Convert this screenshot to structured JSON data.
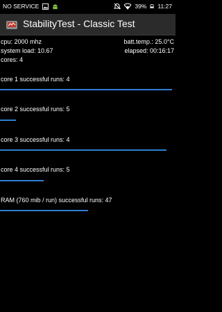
{
  "status_bar": {
    "carrier": "NO SERVICE",
    "battery": "39%",
    "time": "11:27"
  },
  "header": {
    "title": "StabilityTest - Classic Test"
  },
  "stats": {
    "cpu": "cpu: 2000 mhz",
    "batt_temp": "batt.temp.: 25.0°C",
    "system_load": "system load: 10.67",
    "elapsed": "elapsed: 00:16:17",
    "cores": "cores: 4"
  },
  "tests": [
    {
      "label": "core 1 successful runs: 4",
      "progress": 0.98
    },
    {
      "label": "core 2 successful runs: 5",
      "progress": 0.09
    },
    {
      "label": "core 3 successful runs: 4",
      "progress": 0.95
    },
    {
      "label": "core 4 successful runs: 5",
      "progress": 0.25
    },
    {
      "label": "RAM (760 mib / run) successful runs: 47",
      "progress": 0.5
    }
  ],
  "colors": {
    "progress_bar": "#2f7fd3"
  }
}
